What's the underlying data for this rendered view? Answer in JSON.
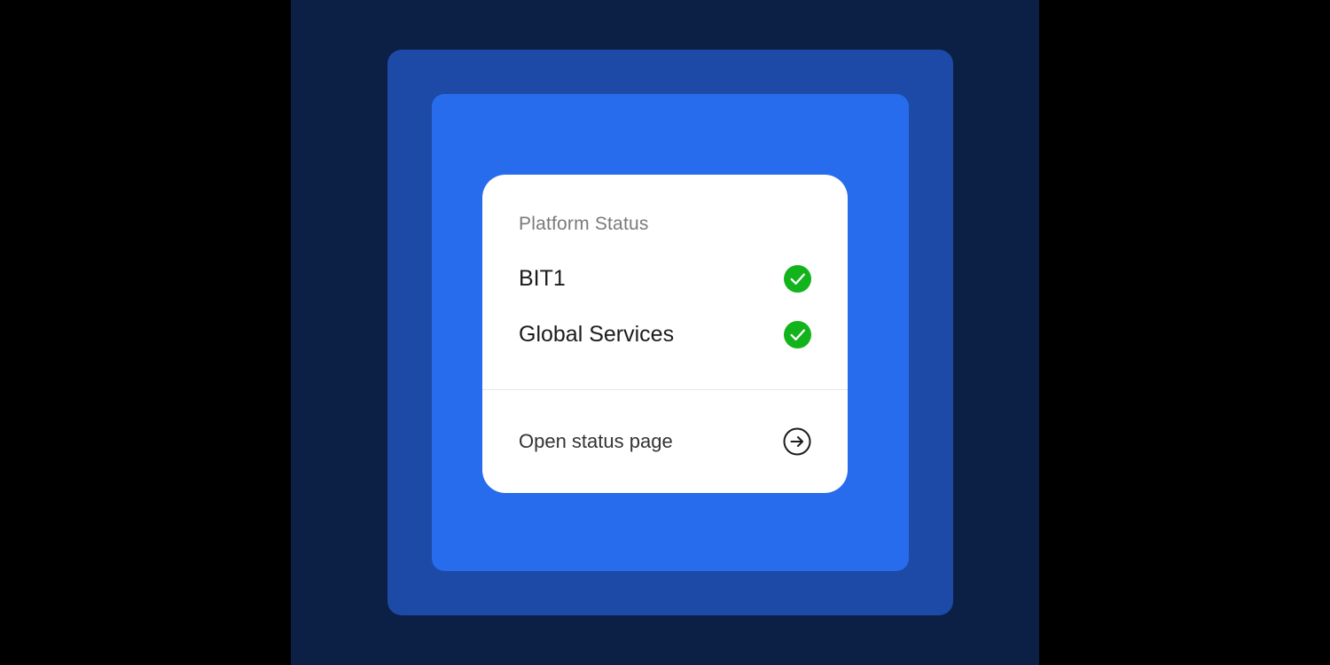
{
  "colors": {
    "page_bg": "#000000",
    "stage_bg": "#0c1f45",
    "outer_frame": "#1d4aa6",
    "inner_frame": "#276ced",
    "card_bg": "#ffffff",
    "status_ok": "#13b31b"
  },
  "widget": {
    "title": "Platform Status",
    "services": [
      {
        "name": "BIT1",
        "status": "operational",
        "icon": "check-circle-icon"
      },
      {
        "name": "Global Services",
        "status": "operational",
        "icon": "check-circle-icon"
      }
    ],
    "link": {
      "label": "Open status page",
      "icon": "arrow-right-circle-icon"
    }
  }
}
